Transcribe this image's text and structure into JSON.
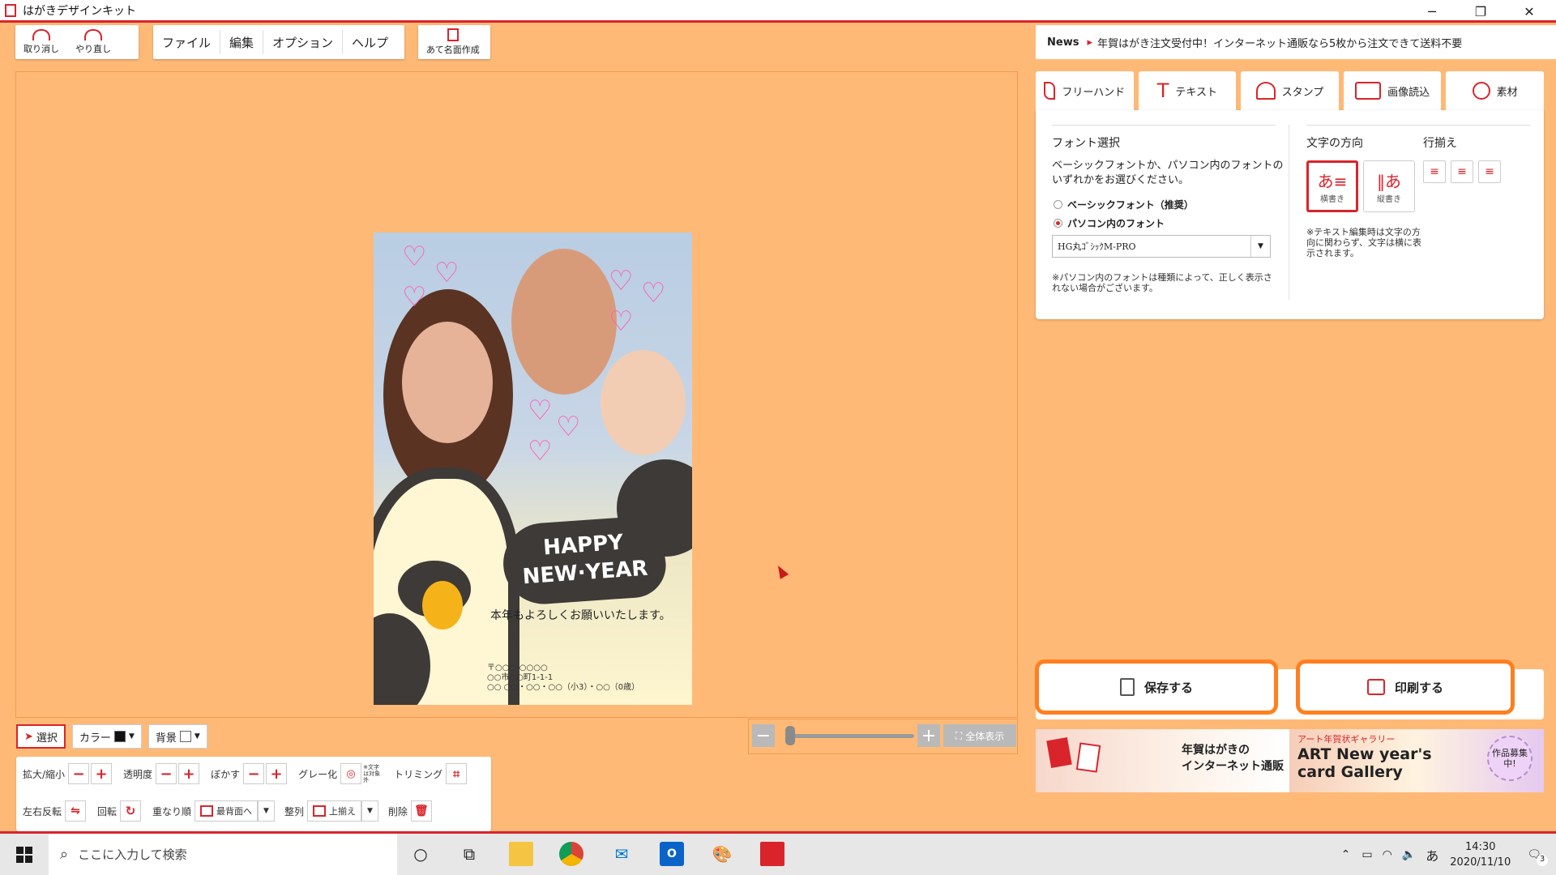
{
  "window": {
    "title": "はがきデザインキット"
  },
  "toolbar": {
    "undo": "取り消し",
    "redo": "やり直し",
    "menus": [
      "ファイル",
      "編集",
      "オプション",
      "ヘルプ"
    ],
    "address": "あて名面作成"
  },
  "news": {
    "label": "News",
    "text": "年賀はがき注文受付中！インターネット通販なら5枚から注文できて送料不要"
  },
  "tool_tabs": [
    "フリーハンド",
    "テキスト",
    "スタンプ",
    "画像読込",
    "素材"
  ],
  "text_panel": {
    "font_heading": "フォント選択",
    "description": "ベーシックフォントか、パソコン内のフォントのいずれかをお選びください。",
    "radio_basic": "ベーシックフォント（推奨）",
    "radio_pc": "パソコン内のフォント",
    "selected_font": "HG丸ｺﾞｼｯｸM-PRO",
    "font_note": "※パソコン内のフォントは種類によって、正しく表示されない場合がございます。",
    "direction_heading": "文字の方向",
    "horizontal": "横書き",
    "vertical": "縦書き",
    "align_heading": "行揃え",
    "direction_note": "※テキスト編集時は文字の方向に関わらず、文字は横に表示されます。"
  },
  "card": {
    "happy": "HAPPY",
    "new_year": "NEW·YEAR",
    "greeting": "本年もよろしくお願いいたします。",
    "addr1": "〒○○○-○○○○",
    "addr2": "○○市○○町1-1-1",
    "addr3": "○○ ○○・○○・○○（小3）・○○（0歳）"
  },
  "actions": {
    "save": "保存する",
    "print": "印刷する"
  },
  "banners": {
    "left_text": "年賀はがきの\nインターネット通販",
    "right_small": "アート年賀状ギャラリー",
    "right_title": "ART New year's card Gallery",
    "right_badge": "作品募集中!"
  },
  "zoom": {
    "full_view": "全体表示",
    "level": 0.05
  },
  "edit": {
    "select": "選択",
    "color": "カラー",
    "background": "背景",
    "scale": "拡大/縮小",
    "opacity": "透明度",
    "blur": "ぼかす",
    "grayscale": "グレー化",
    "grayscale_note": "※文字は対象外",
    "trim": "トリミング",
    "flip": "左右反転",
    "rotate": "回転",
    "order": "重なり順",
    "order_value": "最背面へ",
    "align": "整列",
    "align_value": "上揃え",
    "delete": "削除"
  },
  "taskbar": {
    "search_placeholder": "ここに入力して検索",
    "ime": "あ",
    "time": "14:30",
    "date": "2020/11/10",
    "notifications": "3"
  },
  "colors": {
    "accent": "#d9242b",
    "canvas_bg": "#ffb976",
    "highlight": "#ff7f1f"
  }
}
